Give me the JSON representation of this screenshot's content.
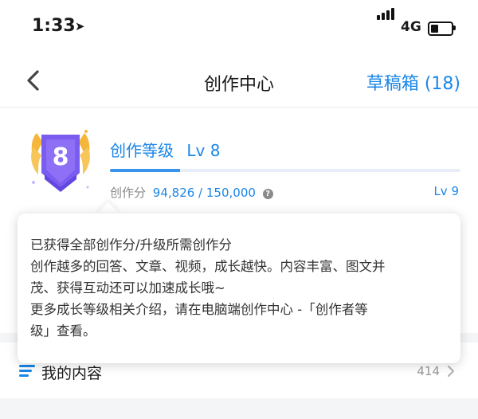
{
  "status_bar": {
    "time": "1:33",
    "network": "4G"
  },
  "nav": {
    "title": "创作中心",
    "drafts": "草稿箱 (18)"
  },
  "level": {
    "badge_number": "8",
    "title": "创作等级",
    "level": "Lv 8",
    "points_label": "创作分",
    "points_value": "94,826 / 150,000",
    "progress": 0.2,
    "next_level": "Lv 9"
  },
  "tooltip": {
    "lines": [
      "已获得全部创作分/升级所需创作分",
      "创作越多的回答、文章、视频，成长越快。内容丰富、图文并",
      "茂、获得互动还可以加速成长哦~",
      "更多成长等级相关介绍，请在电脑端创作中心 -「创作者等",
      "级」查看。"
    ]
  },
  "my_content": {
    "label": "我的内容",
    "count": "414"
  },
  "colors": {
    "accent": "#1a86e8",
    "badge_purple": "#7b5cf0",
    "badge_gold": "#f5b73b"
  },
  "icons": {
    "location": "location-arrow-icon",
    "back": "chevron-left-icon",
    "help": "question-circle-icon",
    "list": "list-icon",
    "chevron": "chevron-right-icon"
  }
}
